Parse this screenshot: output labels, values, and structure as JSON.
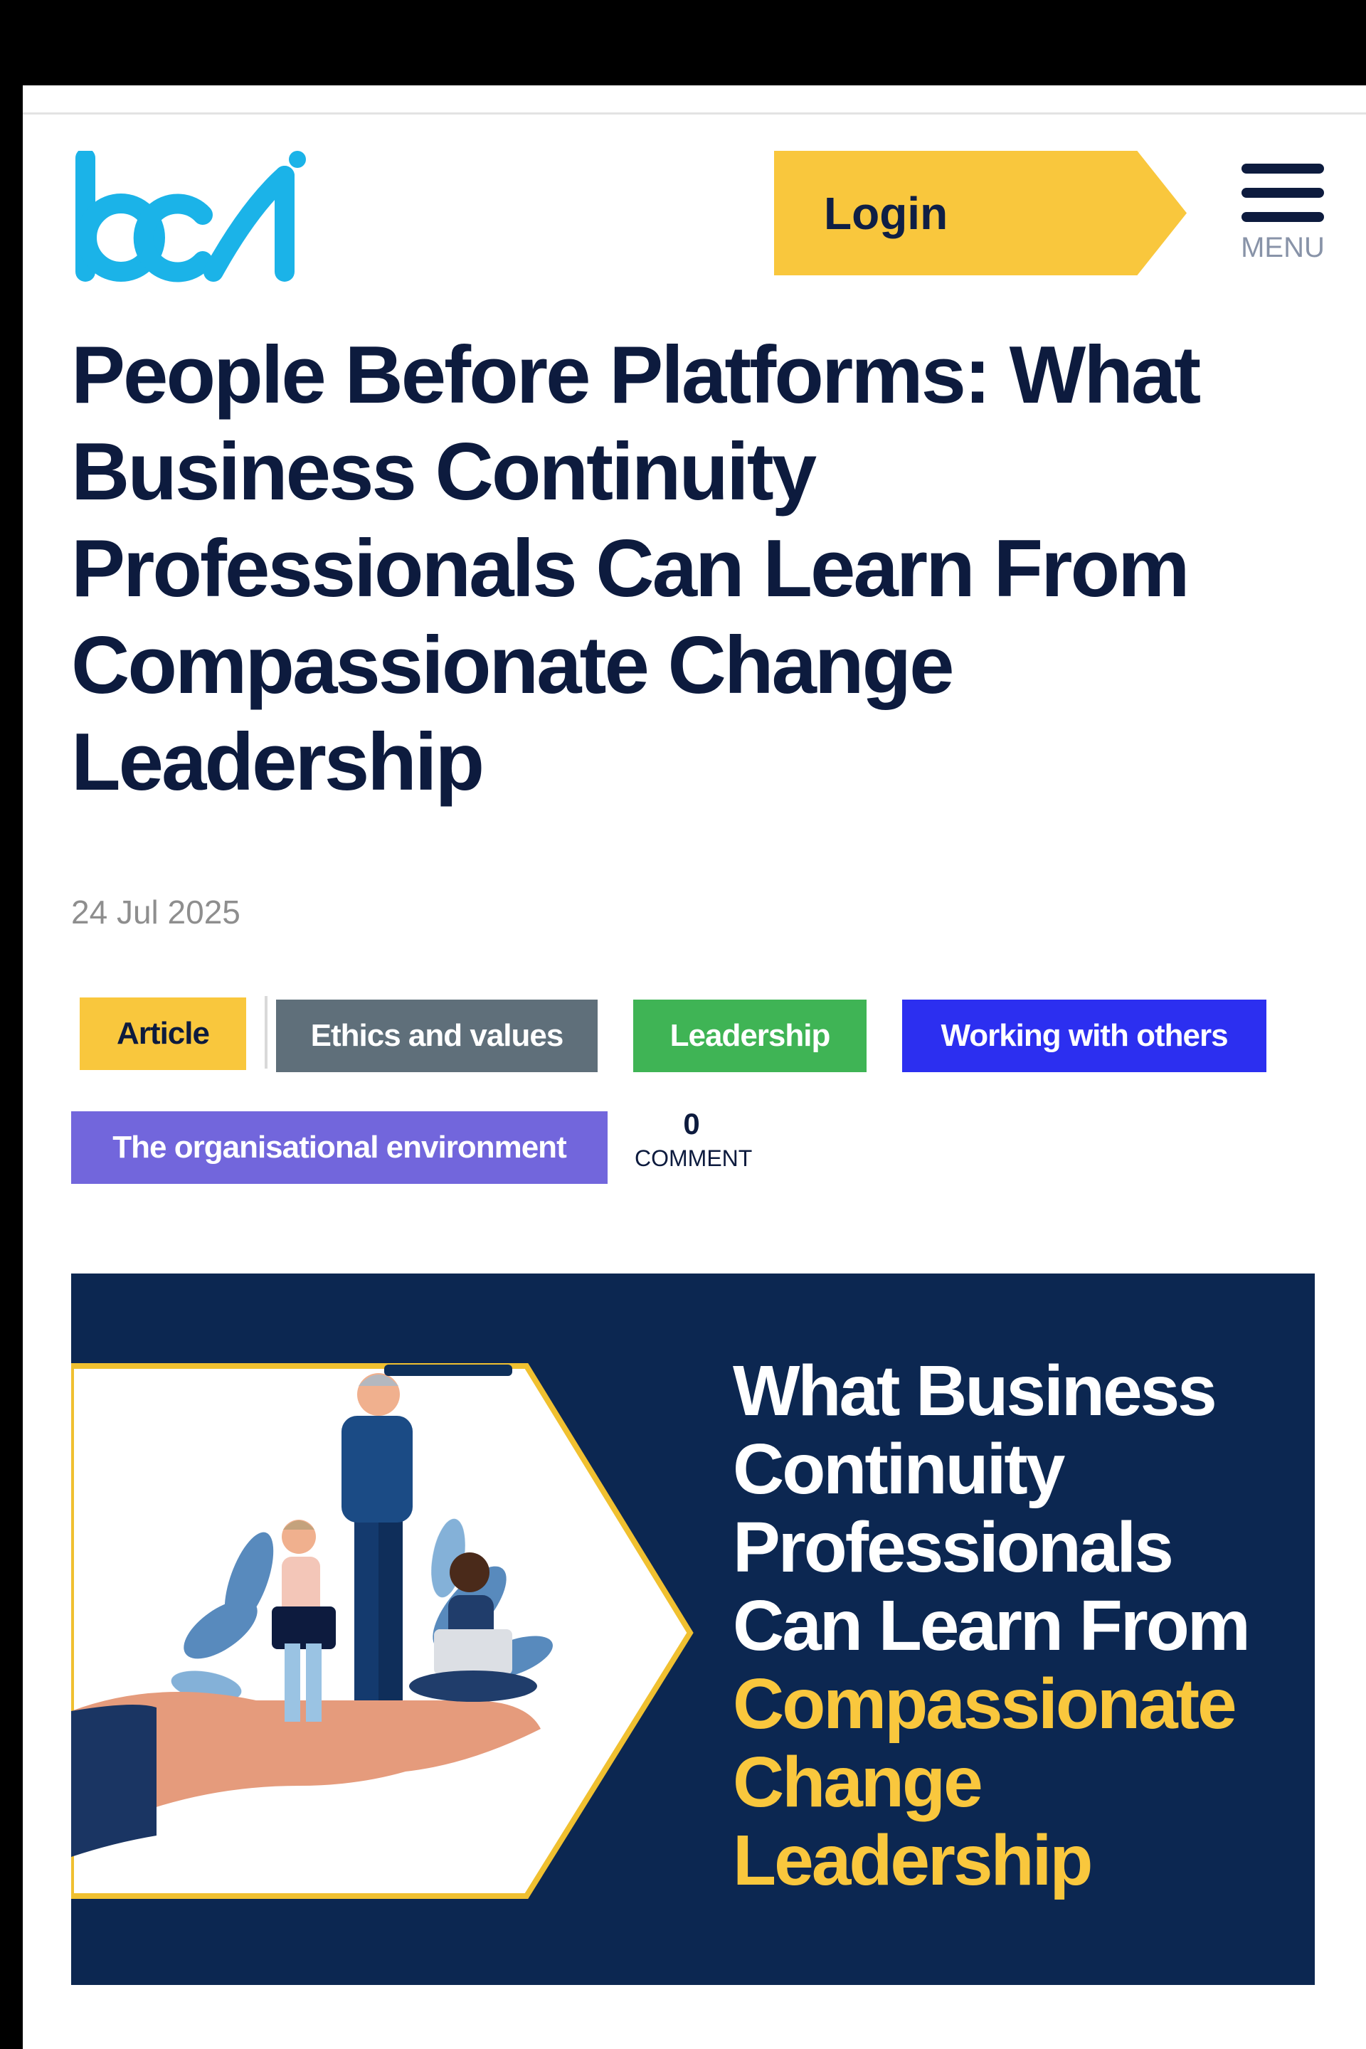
{
  "header": {
    "logo_text": "bci",
    "login_label": "Login",
    "menu_label": "MENU"
  },
  "article": {
    "title": "People Before Platforms: What Business Continuity Professionals Can Learn From Compassionate Change Leadership",
    "date": "24 Jul 2025",
    "tags": [
      {
        "label": "Article",
        "color": "#f9c73d"
      },
      {
        "label": "Ethics and values",
        "color": "#5f6f7a"
      },
      {
        "label": "Leadership",
        "color": "#3fb455"
      },
      {
        "label": "Working with others",
        "color": "#2c2ff0"
      },
      {
        "label": "The organisational environment",
        "color": "#7266dc"
      }
    ],
    "comments": {
      "count": "0",
      "label": "COMMENT"
    }
  },
  "hero": {
    "white_lines": [
      "What Business",
      "Continuity",
      "Professionals",
      "Can Learn From"
    ],
    "yellow_lines": [
      "Compassionate",
      "Change",
      "Leadership"
    ]
  },
  "colors": {
    "navy": "#0d1b3e",
    "accent_yellow": "#f9c73d",
    "logo_cyan": "#1bb3e8",
    "hero_bg": "#0c2751"
  }
}
